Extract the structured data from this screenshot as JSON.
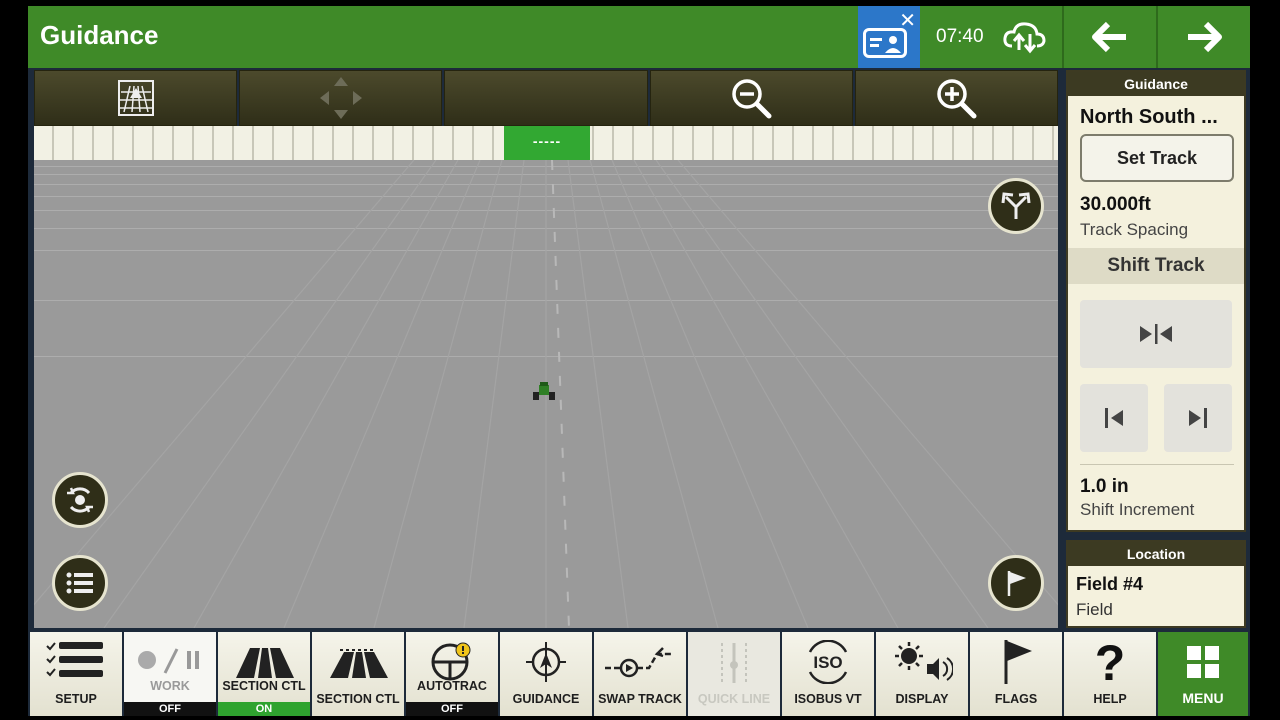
{
  "header": {
    "title": "Guidance",
    "clock": "07:40",
    "icons": [
      "operator-card-icon",
      "close-icon",
      "cloud-sync-icon",
      "arrow-left-icon",
      "arrow-right-icon"
    ]
  },
  "map_toolbar": {
    "icons": [
      "map-view-icon",
      "pan-icon",
      "blank",
      "zoom-out-icon",
      "zoom-in-icon"
    ]
  },
  "lightbar": {
    "center_text": "-----"
  },
  "guidance_panel": {
    "header": "Guidance",
    "line_name": "North South ...",
    "set_track_label": "Set Track",
    "track_spacing_value": "30.000ft",
    "track_spacing_label": "Track Spacing",
    "shift_track_label": "Shift Track",
    "shift_increment_value": "1.0 in",
    "shift_increment_label": "Shift Increment"
  },
  "location_panel": {
    "header": "Location",
    "field_name": "Field #4",
    "field_type": "Field"
  },
  "bottom_bar": {
    "setup": "SETUP",
    "work": "WORK",
    "work_state": "OFF",
    "section_ctl_1": "SECTION CTL",
    "section_ctl_1_state": "ON",
    "section_ctl_2": "SECTION CTL",
    "autotrac": "AUTOTRAC",
    "autotrac_state": "OFF",
    "guidance": "GUIDANCE",
    "swap_track": "SWAP TRACK",
    "quick_line": "QUICK LINE",
    "isobus_vt": "ISOBUS VT",
    "display": "DISPLAY",
    "flags": "FLAGS",
    "help": "HELP",
    "menu": "MENU"
  },
  "colors": {
    "brand_green": "#3f8a28",
    "dark_olive": "#3c3a22",
    "panel_bg": "#f4f1dd",
    "notif_blue": "#2c77c9",
    "state_on": "#2fa32f"
  }
}
